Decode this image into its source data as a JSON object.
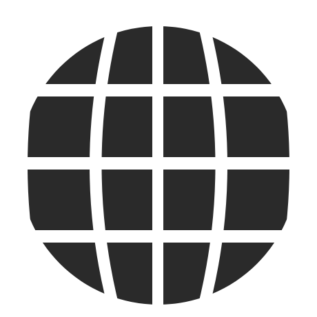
{
  "icon": {
    "name": "globe-icon",
    "colors": {
      "fill": "#2a2a2a",
      "background": "#ffffff"
    }
  }
}
